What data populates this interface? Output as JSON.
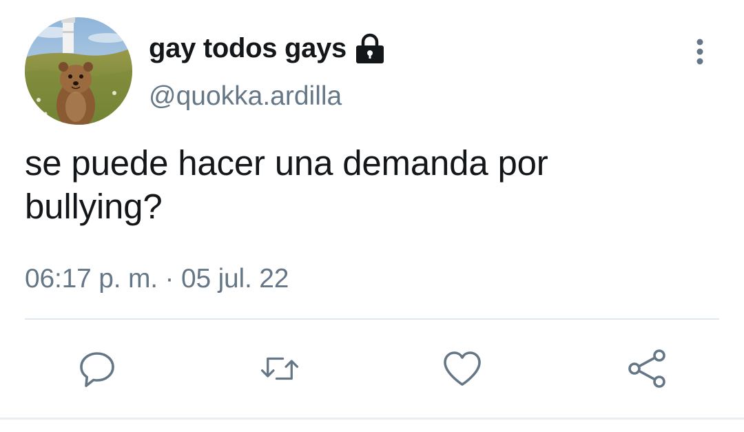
{
  "tweet": {
    "display_name": "gay todos gays",
    "handle": "@quokka.ardilla",
    "protected_icon": "lock-icon",
    "text_line1": "se puede hacer una demanda por",
    "text_line2": "bullying?",
    "timestamp": "06:17 p. m. · 05 jul. 22"
  },
  "actions": {
    "reply_icon": "reply-icon",
    "retweet_icon": "retweet-icon",
    "like_icon": "heart-icon",
    "share_icon": "share-icon",
    "more_icon": "more-vertical-icon"
  },
  "colors": {
    "text": "#14171a",
    "secondary": "#657786",
    "divider": "#e1e8ed"
  }
}
